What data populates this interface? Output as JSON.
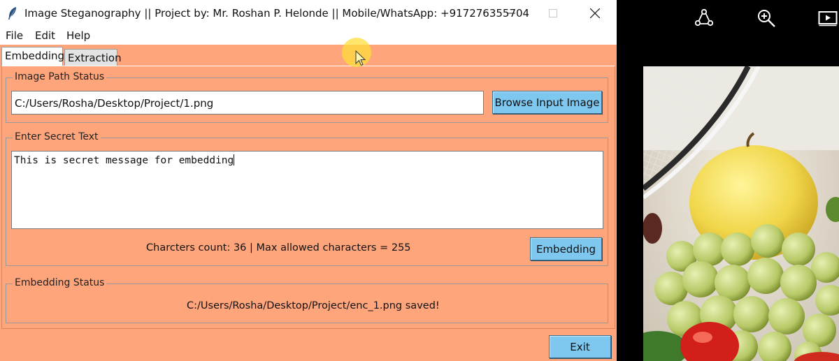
{
  "window": {
    "title": "Image Steganography || Project by: Mr. Roshan P. Helonde || Mobile/WhatsApp: +917276355704",
    "icon": "feather-icon",
    "controls": [
      "minimize-icon",
      "maximize-icon",
      "close-icon"
    ]
  },
  "menu": {
    "file": "File",
    "edit": "Edit",
    "help": "Help"
  },
  "tabs": {
    "embedding": "Embedding",
    "extraction": "Extraction",
    "active": "Embedding"
  },
  "image_path": {
    "group_label": "Image Path Status",
    "value": "C:/Users/Rosha/Desktop/Project/1.png",
    "browse_label": "Browse Input Image"
  },
  "secret": {
    "group_label": "Enter Secret Text",
    "value": "This is secret message for embedding",
    "count_text": "Charcters count: 36 | Max allowed characters = 255",
    "embed_label": "Embedding"
  },
  "status": {
    "group_label": "Embedding Status",
    "text": "C:/Users/Rosha/Desktop/Project/enc_1.png saved!"
  },
  "footer": {
    "exit_label": "Exit"
  },
  "viewer": {
    "tools": [
      "share-icon",
      "zoom-in-icon",
      "slideshow-icon"
    ]
  },
  "colors": {
    "panel_background": "#ffa57c",
    "button_background": "#7ec8f0",
    "cursor_highlight": "#ffde3c"
  }
}
